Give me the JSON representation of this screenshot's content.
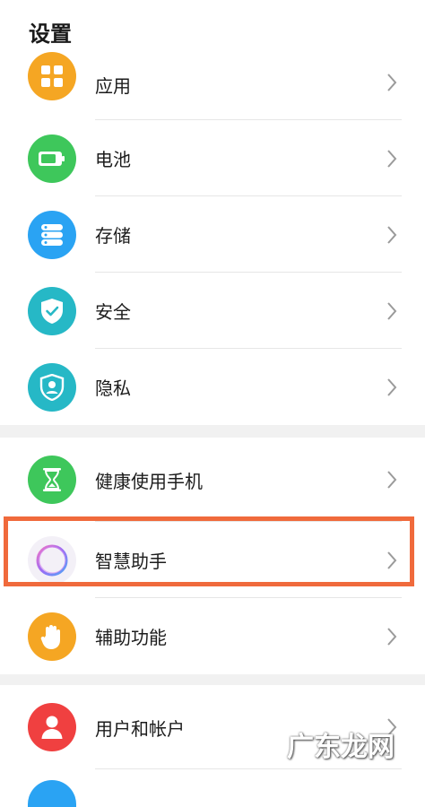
{
  "header": {
    "title": "设置"
  },
  "items": [
    {
      "label": "应用",
      "icon": "apps-grid-icon",
      "color": "#f5a623"
    },
    {
      "label": "电池",
      "icon": "battery-icon",
      "color": "#3ec75b"
    },
    {
      "label": "存储",
      "icon": "storage-icon",
      "color": "#2aa3f3"
    },
    {
      "label": "安全",
      "icon": "shield-check-icon",
      "color": "#26b8c6"
    },
    {
      "label": "隐私",
      "icon": "privacy-shield-icon",
      "color": "#26b8c6"
    },
    {
      "label": "健康使用手机",
      "icon": "hourglass-icon",
      "color": "#3ec75b"
    },
    {
      "label": "智慧助手",
      "icon": "assistant-ring-icon",
      "color": "#a36ef0"
    },
    {
      "label": "辅助功能",
      "icon": "hand-icon",
      "color": "#f5a623"
    },
    {
      "label": "用户和帐户",
      "icon": "user-icon",
      "color": "#f04040"
    }
  ],
  "watermark": "广东龙网",
  "highlight_color": "#f06a3c"
}
